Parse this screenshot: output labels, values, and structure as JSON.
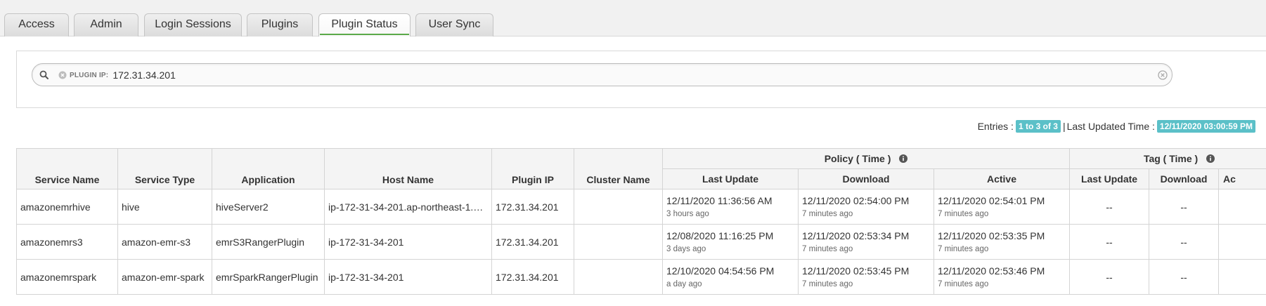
{
  "tabs": [
    {
      "label": "Access"
    },
    {
      "label": "Admin"
    },
    {
      "label": "Login Sessions"
    },
    {
      "label": "Plugins"
    },
    {
      "label": "Plugin Status",
      "active": true
    },
    {
      "label": "User Sync"
    }
  ],
  "search": {
    "facet_label": "PLUGIN IP:",
    "facet_value": "172.31.34.201"
  },
  "summary": {
    "entries_label": "Entries :",
    "entries_value": "1 to 3 of 3",
    "separator": "|",
    "updated_label": "Last Updated Time :",
    "updated_value": "12/11/2020 03:00:59 PM"
  },
  "table": {
    "group_policy": "Policy ( Time )",
    "group_tag": "Tag ( Time )",
    "headers": {
      "service_name": "Service Name",
      "service_type": "Service Type",
      "application": "Application",
      "host_name": "Host Name",
      "plugin_ip": "Plugin IP",
      "cluster_name": "Cluster Name",
      "last_update": "Last Update",
      "download": "Download",
      "active": "Active",
      "tag_last_update": "Last Update",
      "tag_download": "Download",
      "tag_active": "Ac"
    },
    "rows": [
      {
        "service_name": "amazonemrhive",
        "service_type": "hive",
        "application": "hiveServer2",
        "host_name": "ip-172-31-34-201.ap-northeast-1.co...",
        "plugin_ip": "172.31.34.201",
        "cluster_name": "",
        "last_update": "12/11/2020 11:36:56 AM",
        "last_update_ago": "3 hours ago",
        "download": "12/11/2020 02:54:00 PM",
        "download_ago": "7 minutes ago",
        "active": "12/11/2020 02:54:01 PM",
        "active_ago": "7 minutes ago",
        "tag_last_update": "--",
        "tag_download": "--"
      },
      {
        "service_name": "amazonemrs3",
        "service_type": "amazon-emr-s3",
        "application": "emrS3RangerPlugin",
        "host_name": "ip-172-31-34-201",
        "plugin_ip": "172.31.34.201",
        "cluster_name": "",
        "last_update": "12/08/2020 11:16:25 PM",
        "last_update_ago": "3 days ago",
        "download": "12/11/2020 02:53:34 PM",
        "download_ago": "7 minutes ago",
        "active": "12/11/2020 02:53:35 PM",
        "active_ago": "7 minutes ago",
        "tag_last_update": "--",
        "tag_download": "--"
      },
      {
        "service_name": "amazonemrspark",
        "service_type": "amazon-emr-spark",
        "application": "emrSparkRangerPlugin",
        "host_name": "ip-172-31-34-201",
        "plugin_ip": "172.31.34.201",
        "cluster_name": "",
        "last_update": "12/10/2020 04:54:56 PM",
        "last_update_ago": "a day ago",
        "download": "12/11/2020 02:53:45 PM",
        "download_ago": "7 minutes ago",
        "active": "12/11/2020 02:53:46 PM",
        "active_ago": "7 minutes ago",
        "tag_last_update": "--",
        "tag_download": "--"
      }
    ]
  },
  "colors": {
    "active_tab_underline": "#5ba94a",
    "badge": "#5bc0c8"
  }
}
